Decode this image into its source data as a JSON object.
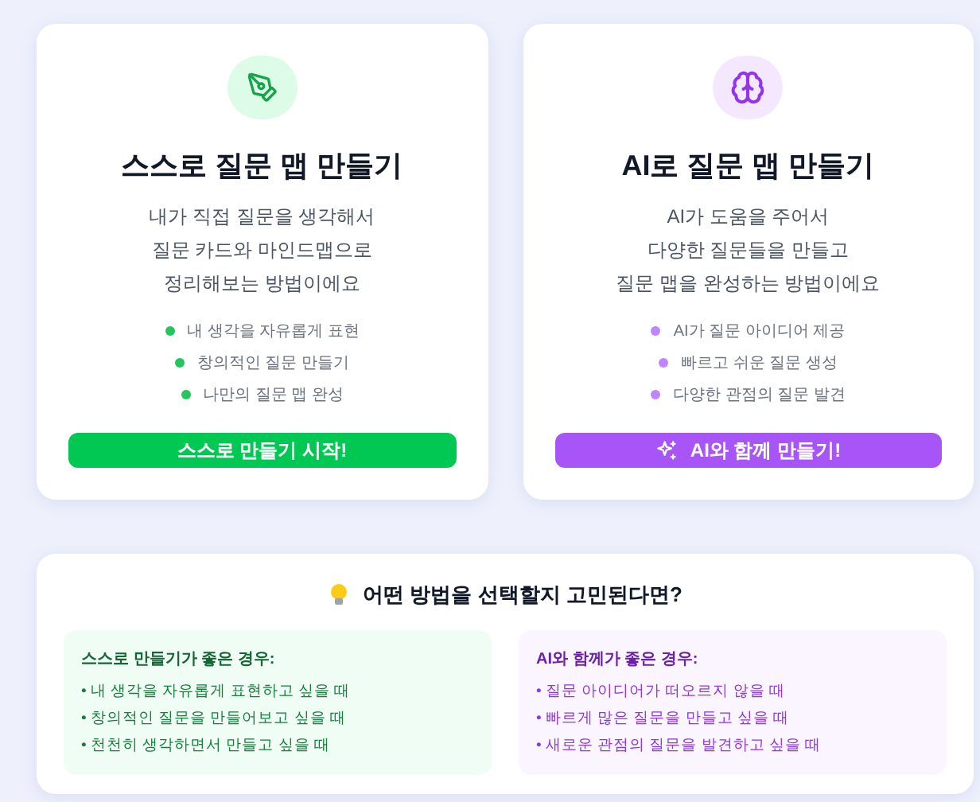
{
  "methods": [
    {
      "kind": "self",
      "title": "스스로 질문 맵 만들기",
      "description": [
        "내가 직접 질문을 생각해서",
        "질문 카드와 마인드맵으로",
        "정리해보는 방법이에요"
      ],
      "features": [
        "내 생각을 자유롭게 표현",
        "창의적인 질문 만들기",
        "나만의 질문 맵 완성"
      ],
      "button": "스스로 만들기 시작!"
    },
    {
      "kind": "ai",
      "title": "AI로 질문 맵 만들기",
      "description": [
        "AI가 도움을 주어서",
        "다양한 질문들을 만들고",
        "질문 맵을 완성하는 방법이에요"
      ],
      "features": [
        "AI가 질문 아이디어 제공",
        "빠르고 쉬운 질문 생성",
        "다양한 관점의 질문 발견"
      ],
      "button": "AI와 함께 만들기!"
    }
  ],
  "help": {
    "title": "어떤 방법을 선택할지 고민된다면?",
    "panels": [
      {
        "kind": "self",
        "heading": "스스로 만들기가 좋은 경우:",
        "items": [
          "• 내 생각을 자유롭게 표현하고 싶을 때",
          "• 창의적인 질문을 만들어보고 싶을 때",
          "• 천천히 생각하면서 만들고 싶을 때"
        ]
      },
      {
        "kind": "ai",
        "heading": "AI와 함께가 좋은 경우:",
        "items": [
          "• 질문 아이디어가 떠오르지 않을 때",
          "• 빠르게 많은 질문을 만들고 싶을 때",
          "• 새로운 관점의 질문을 발견하고 싶을 때"
        ]
      }
    ]
  }
}
